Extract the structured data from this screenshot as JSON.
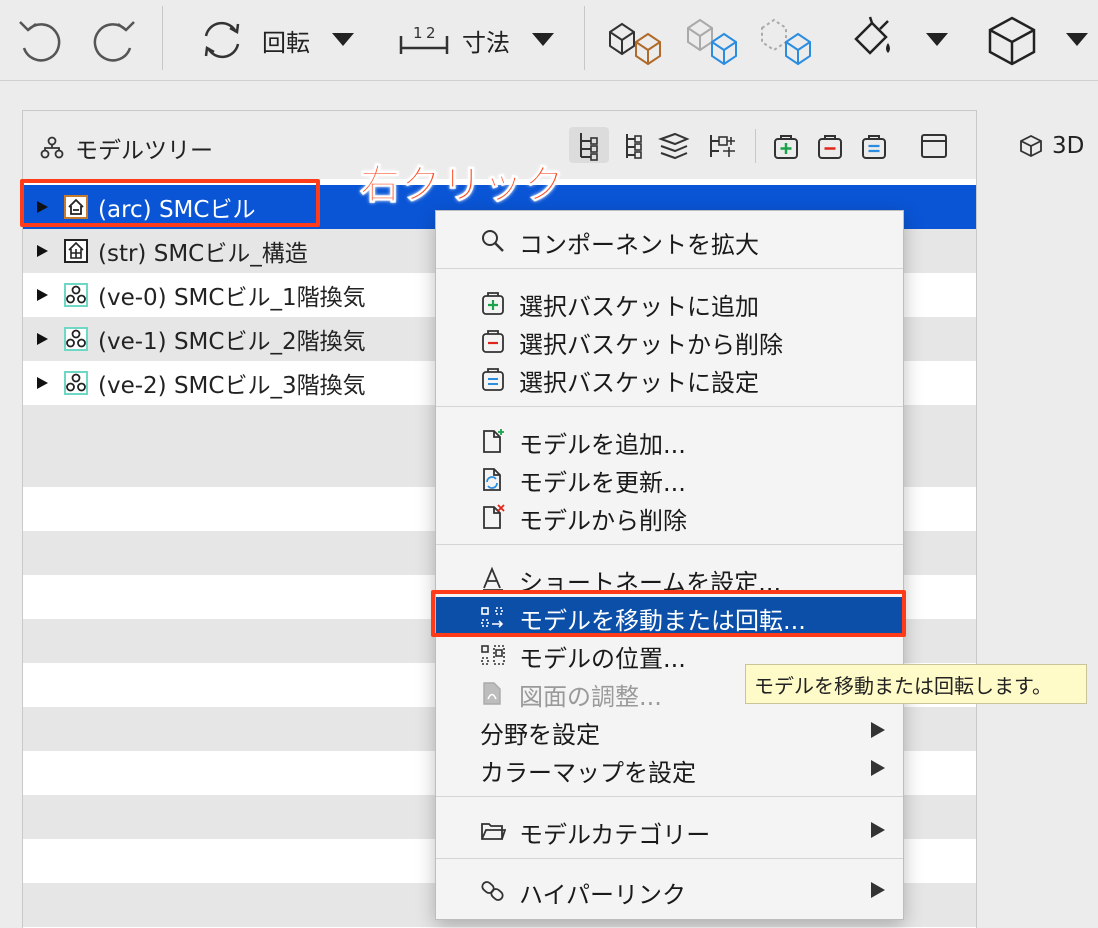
{
  "toolbar": {
    "rotate_label": "回転",
    "dimension_label": "寸法"
  },
  "panel": {
    "title": "モデルツリー"
  },
  "view3d_label": "3D",
  "tree": [
    {
      "label": "(arc) SMCビル",
      "icon": "building-icon",
      "selected": true
    },
    {
      "label": "(str) SMCビル_構造",
      "icon": "structure-icon",
      "selected": false
    },
    {
      "label": "(ve-0) SMCビル_1階換気",
      "icon": "ventilation-icon",
      "selected": false
    },
    {
      "label": "(ve-1) SMCビル_2階換気",
      "icon": "ventilation-icon",
      "selected": false
    },
    {
      "label": "(ve-2) SMCビル_3階換気",
      "icon": "ventilation-icon",
      "selected": false
    }
  ],
  "annotation": {
    "right_click": "右クリック"
  },
  "menu": {
    "zoom_component": "コンポーネントを拡大",
    "add_to_basket": "選択バスケットに追加",
    "remove_from_basket": "選択バスケットから削除",
    "set_basket": "選択バスケットに設定",
    "add_model": "モデルを追加...",
    "update_model": "モデルを更新...",
    "delete_model": "モデルから削除",
    "set_short_name": "ショートネームを設定...",
    "move_rotate_model": "モデルを移動または回転...",
    "model_position": "モデルの位置...",
    "adjust_drawing": "図面の調整...",
    "set_discipline": "分野を設定",
    "set_colormap": "カラーマップを設定",
    "model_category": "モデルカテゴリー",
    "hyperlink": "ハイパーリンク"
  },
  "tooltip": "モデルを移動または回転します。",
  "colors": {
    "selection_blue": "#0a55d6",
    "menu_active": "#0b4fa8",
    "annotation_red": "#ff3b1a",
    "tooltip_bg": "#fffbc8"
  }
}
